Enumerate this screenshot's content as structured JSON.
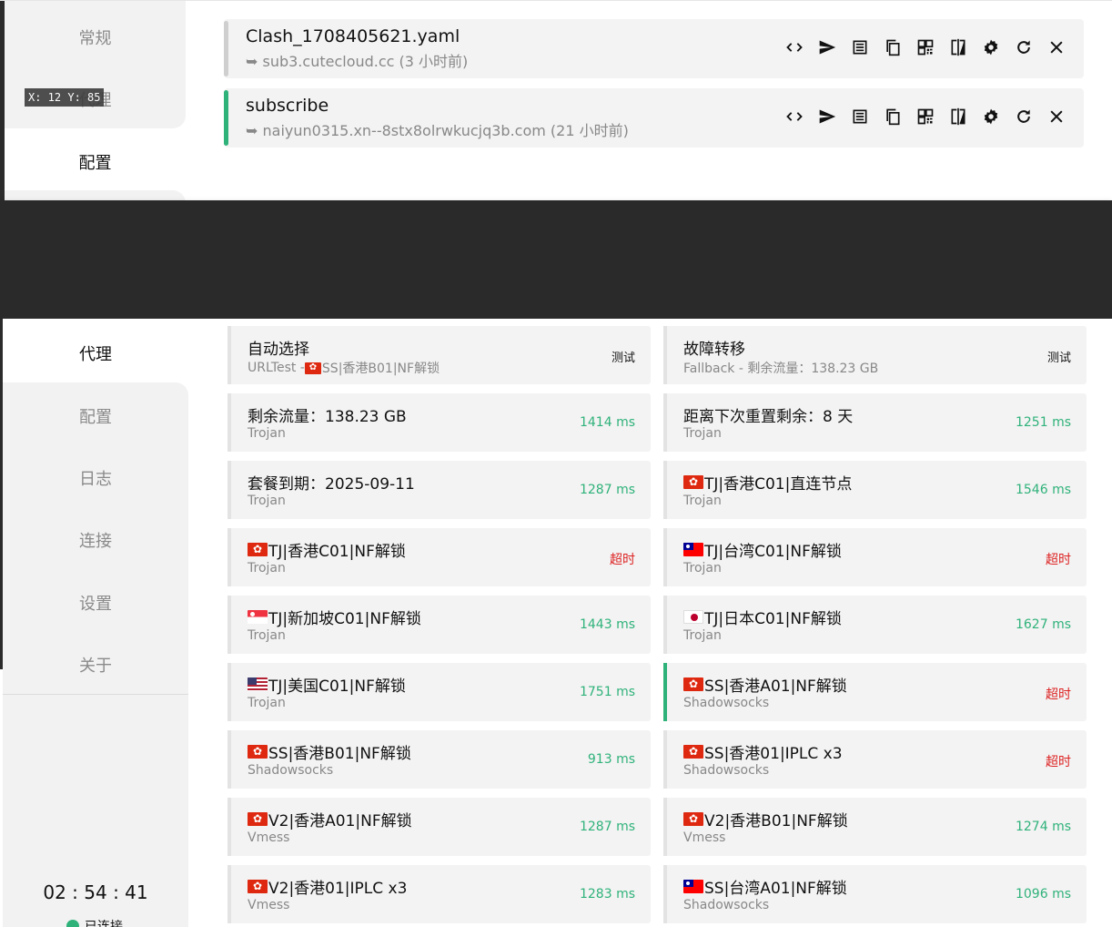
{
  "top_window": {
    "sidebar": [
      "常规",
      "代理",
      "配置"
    ],
    "coord_badge": "X: 12 Y: 85",
    "profiles": [
      {
        "name": "Clash_1708405621.yaml",
        "sub": "➥ sub3.cutecloud.cc (3 小时前)",
        "selected": false
      },
      {
        "name": "subscribe",
        "sub": "➥ naiyun0315.xn--8stx8olrwkucjq3b.com (21 小时前)",
        "selected": true
      }
    ],
    "profile_icons": [
      "code-icon",
      "send-icon",
      "list-icon",
      "copy-icon",
      "qrcode-icon",
      "compare-icon",
      "gear-icon",
      "refresh-icon",
      "close-icon"
    ]
  },
  "bottom_window": {
    "sidebar": [
      "代理",
      "配置",
      "日志",
      "连接",
      "设置",
      "关于"
    ],
    "timer": "02 : 54 : 41",
    "status": "已连接",
    "groups": [
      {
        "title": "自动选择",
        "type": "URLTest - ",
        "type_flag": "hk",
        "type_extra": "SS|香港B01|NF解锁",
        "action": "测试"
      },
      {
        "title": "故障转移",
        "type": "Fallback - 剩余流量：138.23 GB",
        "action": "测试"
      }
    ],
    "proxies": [
      {
        "flag": "",
        "name": "剩余流量：138.23 GB",
        "type": "Trojan",
        "latency": "1414 ms",
        "timeout": false
      },
      {
        "flag": "",
        "name": "距离下次重置剩余：8 天",
        "type": "Trojan",
        "latency": "1251 ms",
        "timeout": false
      },
      {
        "flag": "",
        "name": "套餐到期：2025-09-11",
        "type": "Trojan",
        "latency": "1287 ms",
        "timeout": false
      },
      {
        "flag": "hk",
        "name": "TJ|香港C01|直连节点",
        "type": "Trojan",
        "latency": "1546 ms",
        "timeout": false
      },
      {
        "flag": "hk",
        "name": "TJ|香港C01|NF解锁",
        "type": "Trojan",
        "latency": "超时",
        "timeout": true
      },
      {
        "flag": "tw",
        "name": "TJ|台湾C01|NF解锁",
        "type": "Trojan",
        "latency": "超时",
        "timeout": true
      },
      {
        "flag": "sg",
        "name": "TJ|新加坡C01|NF解锁",
        "type": "Trojan",
        "latency": "1443 ms",
        "timeout": false
      },
      {
        "flag": "jp",
        "name": "TJ|日本C01|NF解锁",
        "type": "Trojan",
        "latency": "1627 ms",
        "timeout": false
      },
      {
        "flag": "us",
        "name": "TJ|美国C01|NF解锁",
        "type": "Trojan",
        "latency": "1751 ms",
        "timeout": false
      },
      {
        "flag": "hk",
        "name": "SS|香港A01|NF解锁",
        "type": "Shadowsocks",
        "latency": "超时",
        "timeout": true,
        "selected": true
      },
      {
        "flag": "hk",
        "name": "SS|香港B01|NF解锁",
        "type": "Shadowsocks",
        "latency": "913 ms",
        "timeout": false
      },
      {
        "flag": "hk",
        "name": "SS|香港01|IPLC x3",
        "type": "Shadowsocks",
        "latency": "超时",
        "timeout": true
      },
      {
        "flag": "hk",
        "name": "V2|香港A01|NF解锁",
        "type": "Vmess",
        "latency": "1287 ms",
        "timeout": false
      },
      {
        "flag": "hk",
        "name": "V2|香港B01|NF解锁",
        "type": "Vmess",
        "latency": "1274 ms",
        "timeout": false
      },
      {
        "flag": "hk",
        "name": "V2|香港01|IPLC x3",
        "type": "Vmess",
        "latency": "1283 ms",
        "timeout": false
      },
      {
        "flag": "tw",
        "name": "SS|台湾A01|NF解锁",
        "type": "Shadowsocks",
        "latency": "1096 ms",
        "timeout": false
      }
    ]
  },
  "colors": {
    "accent_green": "#2fb27a",
    "timeout_red": "#dd2222",
    "card_bg": "#f3f3f3"
  }
}
